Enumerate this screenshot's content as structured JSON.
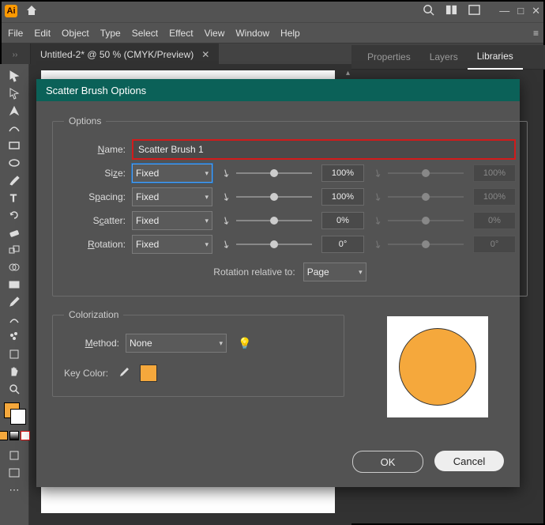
{
  "titlebar": {
    "app_badge": "Ai"
  },
  "menus": [
    "File",
    "Edit",
    "Object",
    "Type",
    "Select",
    "Effect",
    "View",
    "Window",
    "Help"
  ],
  "doc_tab": {
    "title": "Untitled-2* @ 50 % (CMYK/Preview)"
  },
  "right_tabs": [
    "Properties",
    "Layers",
    "Libraries"
  ],
  "right_active": "Libraries",
  "dialog": {
    "title": "Scatter Brush Options",
    "options_legend": "Options",
    "name_label": "Name:",
    "name_value": "Scatter Brush 1",
    "size_label": "Size:",
    "spacing_label": "Spacing:",
    "scatter_label": "Scatter:",
    "rotation_label": "Rotation:",
    "fixed": "Fixed",
    "v_size": "100%",
    "v_spacing": "100%",
    "v_scatter": "0%",
    "v_rotation": "0°",
    "v_size2": "100%",
    "v_spacing2": "100%",
    "v_scatter2": "0%",
    "v_rotation2": "0°",
    "rot_rel_label": "Rotation relative to:",
    "rot_rel_value": "Page",
    "coloriz_legend": "Colorization",
    "method_label": "Method:",
    "method_value": "None",
    "keycolor_label": "Key Color:",
    "ok": "OK",
    "cancel": "Cancel"
  }
}
